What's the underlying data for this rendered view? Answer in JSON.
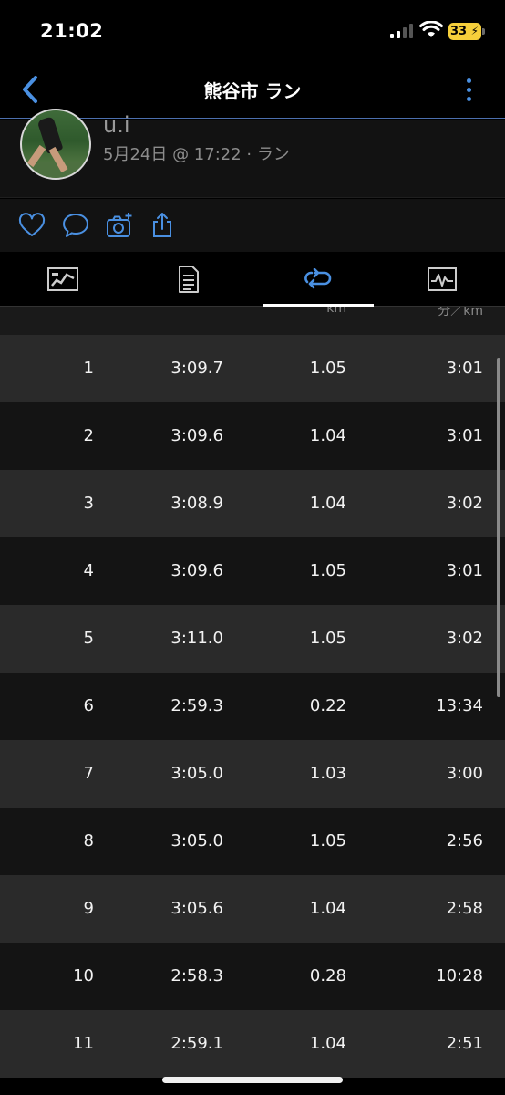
{
  "status": {
    "time": "21:02",
    "battery": "33"
  },
  "nav": {
    "title": "熊谷市 ラン"
  },
  "profile": {
    "name": "u.i",
    "meta": "5月24日 @ 17:22 · ラン"
  },
  "actions": [
    "heart-icon",
    "comment-icon",
    "add-photo-icon",
    "share-icon"
  ],
  "tabs": [
    "overview-tab",
    "details-tab",
    "laps-tab",
    "stats-tab"
  ],
  "table_header": {
    "distance_unit": "km",
    "pace_unit": "分／km"
  },
  "laps": [
    {
      "lap": "1",
      "time": "3:09.7",
      "distance": "1.05",
      "pace": "3:01"
    },
    {
      "lap": "2",
      "time": "3:09.6",
      "distance": "1.04",
      "pace": "3:01"
    },
    {
      "lap": "3",
      "time": "3:08.9",
      "distance": "1.04",
      "pace": "3:02"
    },
    {
      "lap": "4",
      "time": "3:09.6",
      "distance": "1.05",
      "pace": "3:01"
    },
    {
      "lap": "5",
      "time": "3:11.0",
      "distance": "1.05",
      "pace": "3:02"
    },
    {
      "lap": "6",
      "time": "2:59.3",
      "distance": "0.22",
      "pace": "13:34"
    },
    {
      "lap": "7",
      "time": "3:05.0",
      "distance": "1.03",
      "pace": "3:00"
    },
    {
      "lap": "8",
      "time": "3:05.0",
      "distance": "1.05",
      "pace": "2:56"
    },
    {
      "lap": "9",
      "time": "3:05.6",
      "distance": "1.04",
      "pace": "2:58"
    },
    {
      "lap": "10",
      "time": "2:58.3",
      "distance": "0.28",
      "pace": "10:28"
    },
    {
      "lap": "11",
      "time": "2:59.1",
      "distance": "1.04",
      "pace": "2:51"
    }
  ],
  "colors": {
    "accent": "#4a90e2",
    "battery": "#f6cf3b"
  }
}
